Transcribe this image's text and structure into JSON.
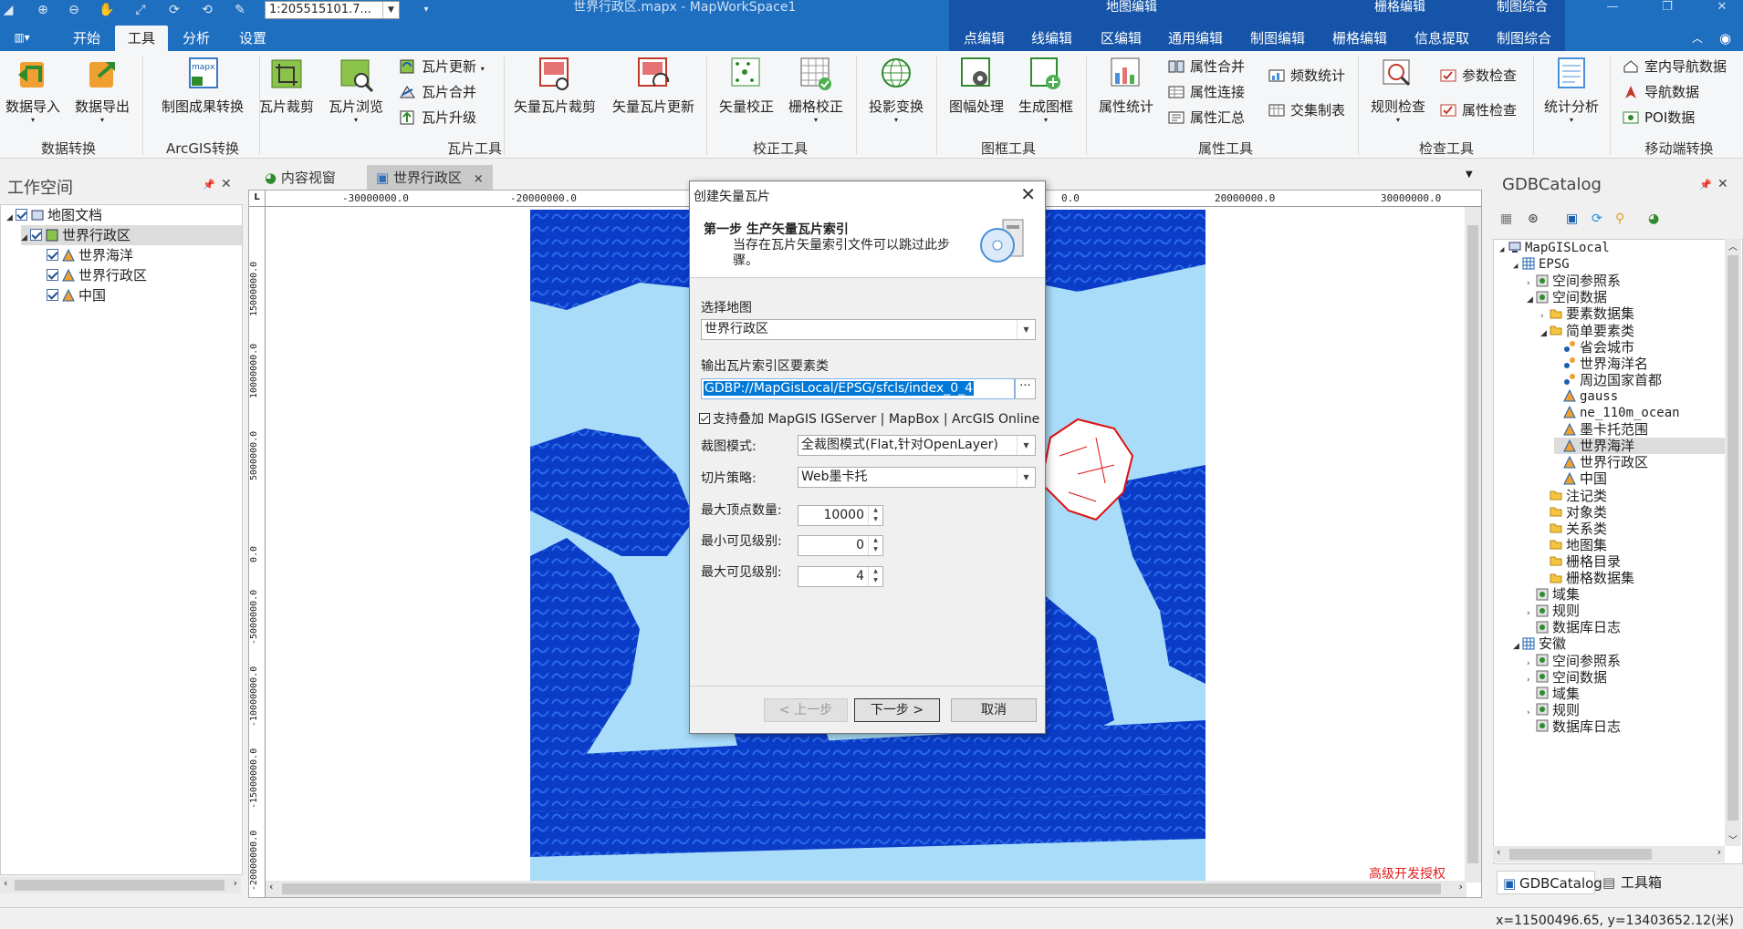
{
  "titlebar": {
    "scale_value": "1:205515101.7...",
    "window_title": "世界行政区.mapx - MapWorkSpace1",
    "context_groups": [
      "地图编辑",
      "栅格编辑",
      "制图综合"
    ]
  },
  "tabs": {
    "main": [
      "开始",
      "工具",
      "分析",
      "设置"
    ],
    "active": "工具",
    "context": [
      "点编辑",
      "线编辑",
      "区编辑",
      "通用编辑",
      "制图编辑",
      "栅格编辑",
      "信息提取",
      "制图综合"
    ]
  },
  "ribbon": {
    "data_convert": {
      "import": "数据导入",
      "export": "数据导出",
      "group": "数据转换"
    },
    "arcgis": {
      "result_convert": "制图成果转换",
      "mapx_badge": "mapx",
      "group": "ArcGIS转换"
    },
    "tile_tools": {
      "clip": "瓦片裁剪",
      "browse": "瓦片浏览",
      "update": "瓦片更新",
      "merge": "瓦片合并",
      "upgrade": "瓦片升级",
      "vector_clip": "矢量瓦片裁剪",
      "vector_update": "矢量瓦片更新",
      "group": "瓦片工具"
    },
    "correction": {
      "vector": "矢量校正",
      "raster": "栅格校正",
      "group": "校正工具"
    },
    "projection": {
      "label": "投影变换"
    },
    "frame_tools": {
      "sheet": "图幅处理",
      "generate": "生成图框",
      "group": "图框工具"
    },
    "attr_tools": {
      "stats": "属性统计",
      "merge": "属性合并",
      "join": "属性连接",
      "summary": "属性汇总",
      "freq": "频数统计",
      "cross": "交集制表",
      "group": "属性工具"
    },
    "check_tools": {
      "rule": "规则检查",
      "param": "参数检查",
      "attr": "属性检查",
      "group": "检查工具"
    },
    "analysis": {
      "stat": "统计分析"
    },
    "mobile": {
      "indoor": "室内导航数据",
      "nav": "导航数据",
      "poi": "POI数据",
      "group": "移动端转换"
    }
  },
  "workspace": {
    "title": "工作空间",
    "tree": [
      {
        "label": "地图文档",
        "level": 0
      },
      {
        "label": "世界行政区",
        "level": 1
      },
      {
        "label": "世界海洋",
        "level": 2
      },
      {
        "label": "世界行政区",
        "level": 2
      },
      {
        "label": "中国",
        "level": 2
      }
    ]
  },
  "doc_tabs": {
    "content_view": "内容视窗",
    "map": "世界行政区",
    "close": "×"
  },
  "map": {
    "ruler_h": [
      "-30000000.0",
      "-20000000.0",
      "0.0",
      "20000000.0",
      "30000000.0"
    ],
    "ruler_v": [
      "15000000.0",
      "10000000.0",
      "5000000.0",
      "0.0",
      "-5000000.0",
      "-10000000.0",
      "-15000000.0",
      "-20000000.0"
    ],
    "watermark": "高级开发授权",
    "colors": {
      "ocean": "#0a3cc8",
      "land": "#a8dcf8",
      "china": "#ffffff",
      "china_border": "#e01010"
    }
  },
  "dialog": {
    "title": "创建矢量瓦片",
    "step_title": "第一步  生产矢量瓦片索引",
    "step_desc": "当存在瓦片矢量索引文件可以跳过此步骤。",
    "select_map_label": "选择地图",
    "select_map_value": "世界行政区",
    "output_label": "输出瓦片索引区要素类",
    "output_path": "GDBP://MapGisLocal/EPSG/sfcls/index_0_4",
    "browse": "···",
    "support_checkbox": "支持叠加 MapGIS IGServer | MapBox | ArcGIS Online",
    "clip_mode_label": "裁图模式:",
    "clip_mode_value": "全裁图模式(Flat,针对OpenLayer)",
    "strategy_label": "切片策略:",
    "strategy_value": "Web墨卡托",
    "max_vertex_label": "最大顶点数量:",
    "max_vertex_value": "10000",
    "min_level_label": "最小可见级别:",
    "min_level_value": "0",
    "max_level_label": "最大可见级别:",
    "max_level_value": "4",
    "prev": "< 上一步",
    "next": "下一步 >",
    "cancel": "取消"
  },
  "gdb": {
    "title": "GDBCatalog",
    "tree": [
      {
        "label": "MapGISLocal",
        "level": 0,
        "mono": true
      },
      {
        "label": "EPSG",
        "level": 1,
        "mono": true
      },
      {
        "label": "空间参照系",
        "level": 2
      },
      {
        "label": "空间数据",
        "level": 2
      },
      {
        "label": "要素数据集",
        "level": 3
      },
      {
        "label": "简单要素类",
        "level": 3
      },
      {
        "label": "省会城市",
        "level": 4
      },
      {
        "label": "世界海洋名",
        "level": 4
      },
      {
        "label": "周边国家首都",
        "level": 4
      },
      {
        "label": "gauss",
        "level": 4,
        "mono": true
      },
      {
        "label": "ne_110m_ocean",
        "level": 4,
        "mono": true
      },
      {
        "label": "墨卡托范围",
        "level": 4
      },
      {
        "label": "世界海洋",
        "level": 4
      },
      {
        "label": "世界行政区",
        "level": 4
      },
      {
        "label": "中国",
        "level": 4
      },
      {
        "label": "注记类",
        "level": 3
      },
      {
        "label": "对象类",
        "level": 3
      },
      {
        "label": "关系类",
        "level": 3
      },
      {
        "label": "地图集",
        "level": 3
      },
      {
        "label": "栅格目录",
        "level": 3
      },
      {
        "label": "栅格数据集",
        "level": 3
      },
      {
        "label": "域集",
        "level": 2
      },
      {
        "label": "规则",
        "level": 2
      },
      {
        "label": "数据库日志",
        "level": 2
      },
      {
        "label": "安徽",
        "level": 1
      },
      {
        "label": "空间参照系",
        "level": 2
      },
      {
        "label": "空间数据",
        "level": 2
      },
      {
        "label": "域集",
        "level": 2
      },
      {
        "label": "规则",
        "level": 2
      },
      {
        "label": "数据库日志",
        "level": 2
      }
    ],
    "bottom_tabs": [
      "GDBCatalog",
      "工具箱"
    ]
  },
  "status": {
    "coords": "x=11500496.65, y=13403652.12(米)"
  }
}
